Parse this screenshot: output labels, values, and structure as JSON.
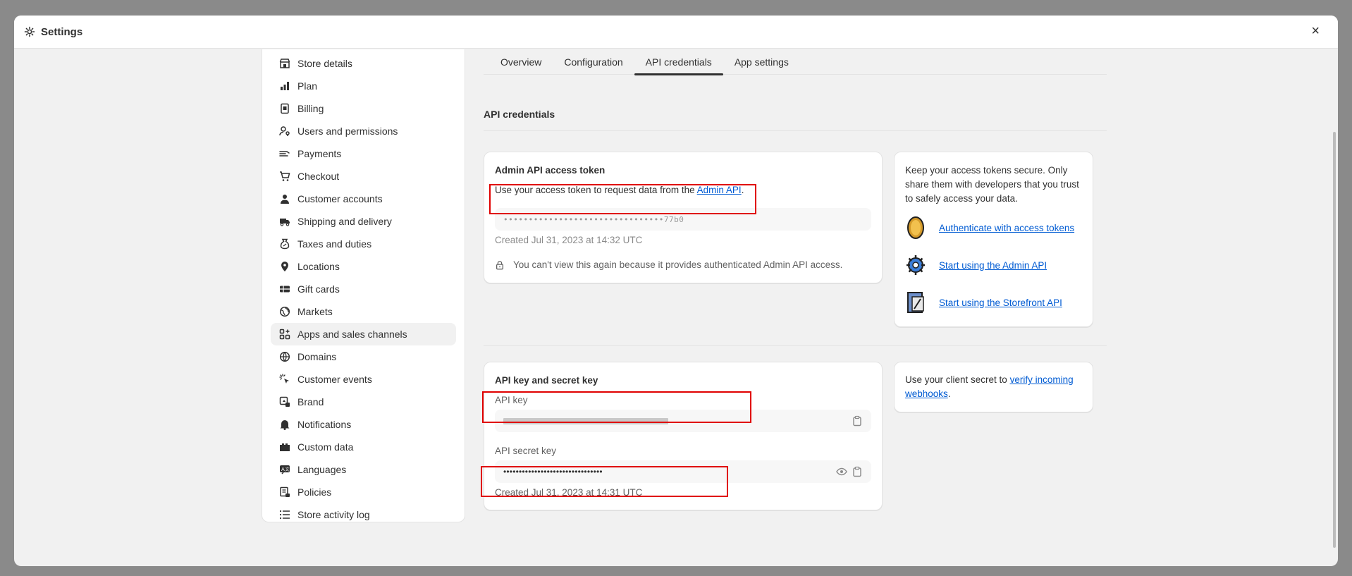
{
  "header": {
    "title": "Settings",
    "close_symbol": "×"
  },
  "sidebar": {
    "items": [
      {
        "label": "Store details",
        "icon": "store-icon"
      },
      {
        "label": "Plan",
        "icon": "plan-icon"
      },
      {
        "label": "Billing",
        "icon": "billing-icon"
      },
      {
        "label": "Users and permissions",
        "icon": "users-icon"
      },
      {
        "label": "Payments",
        "icon": "payments-icon"
      },
      {
        "label": "Checkout",
        "icon": "cart-icon"
      },
      {
        "label": "Customer accounts",
        "icon": "person-icon"
      },
      {
        "label": "Shipping and delivery",
        "icon": "truck-icon"
      },
      {
        "label": "Taxes and duties",
        "icon": "taxes-icon"
      },
      {
        "label": "Locations",
        "icon": "location-icon"
      },
      {
        "label": "Gift cards",
        "icon": "gift-card-icon"
      },
      {
        "label": "Markets",
        "icon": "globe-icon"
      },
      {
        "label": "Apps and sales channels",
        "icon": "apps-icon"
      },
      {
        "label": "Domains",
        "icon": "domain-globe-icon"
      },
      {
        "label": "Customer events",
        "icon": "cursor-icon"
      },
      {
        "label": "Brand",
        "icon": "brand-icon"
      },
      {
        "label": "Notifications",
        "icon": "bell-icon"
      },
      {
        "label": "Custom data",
        "icon": "custom-data-icon"
      },
      {
        "label": "Languages",
        "icon": "language-icon"
      },
      {
        "label": "Policies",
        "icon": "policy-icon"
      },
      {
        "label": "Store activity log",
        "icon": "list-icon"
      }
    ],
    "active_item": "Apps and sales channels"
  },
  "tabs": [
    "Overview",
    "Configuration",
    "API credentials",
    "App settings"
  ],
  "active_tab": "API credentials",
  "section_title": "API credentials",
  "admin_token_card": {
    "title": "Admin API access token",
    "desc_prefix": "Use your access token to request data from the ",
    "desc_link": "Admin API",
    "desc_suffix": ".",
    "token_value": "••••••••••••••••••••••••••••••••77b0",
    "created": "Created Jul 31, 2023 at 14:32 UTC",
    "notice": "You can't view this again because it provides authenticated Admin API access."
  },
  "help_card": {
    "text": "Keep your access tokens secure. Only share them with developers that you trust to safely access your data.",
    "links": [
      {
        "label": "Authenticate with access tokens",
        "icon": "coin-icon"
      },
      {
        "label": "Start using the Admin API",
        "icon": "gear-badge-icon"
      },
      {
        "label": "Start using the Storefront API",
        "icon": "storefront-doc-icon"
      }
    ]
  },
  "api_key_card": {
    "title": "API key and secret key",
    "api_key_label": "API key",
    "api_secret_label": "API secret key",
    "api_secret_value": "••••••••••••••••••••••••••••••••",
    "created": "Created Jul 31, 2023 at 14:31 UTC"
  },
  "webhook_card": {
    "prefix": "Use your client secret to ",
    "link": "verify incoming webhooks",
    "suffix": "."
  },
  "colors": {
    "accent_link": "#005bd3",
    "annotation_red": "#e00000"
  }
}
